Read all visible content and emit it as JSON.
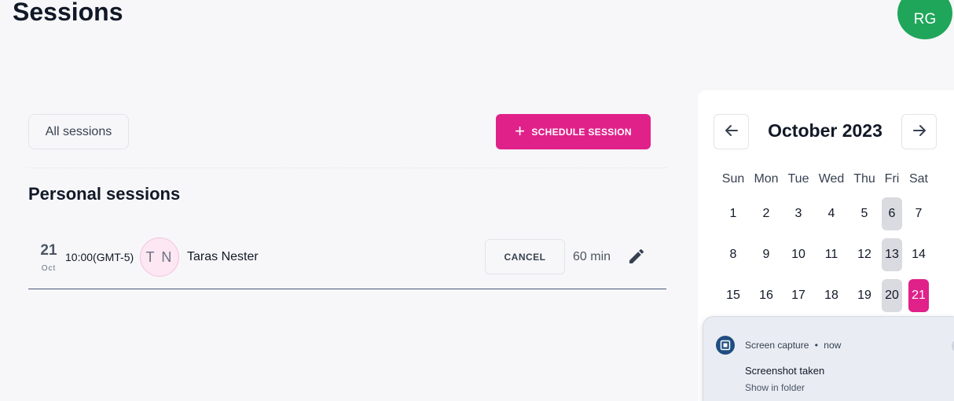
{
  "header": {
    "title": "Sessions",
    "user_initials": "RG",
    "avatar_color": "#1fa65a"
  },
  "toolbar": {
    "filter_label": "All sessions",
    "schedule_label": "SCHEDULE SESSION",
    "accent_color": "#e0218a"
  },
  "section": {
    "title": "Personal sessions"
  },
  "sessions": [
    {
      "day": "21",
      "month": "Oct",
      "time": "10:00(GMT-5)",
      "initials": "T N",
      "name": "Taras Nester",
      "cancel_label": "CANCEL",
      "duration": "60 min"
    }
  ],
  "calendar": {
    "month_label": "October 2023",
    "weekdays": [
      "Sun",
      "Mon",
      "Tue",
      "Wed",
      "Thu",
      "Fri",
      "Sat"
    ],
    "weeks": [
      [
        "1",
        "2",
        "3",
        "4",
        "5",
        "6",
        "7"
      ],
      [
        "8",
        "9",
        "10",
        "11",
        "12",
        "13",
        "14"
      ],
      [
        "15",
        "16",
        "17",
        "18",
        "19",
        "20",
        "21"
      ]
    ],
    "selected_day": "21"
  },
  "notification": {
    "app": "Screen capture",
    "separator": "•",
    "time": "now",
    "title": "Screenshot taken",
    "action": "Show in folder"
  }
}
